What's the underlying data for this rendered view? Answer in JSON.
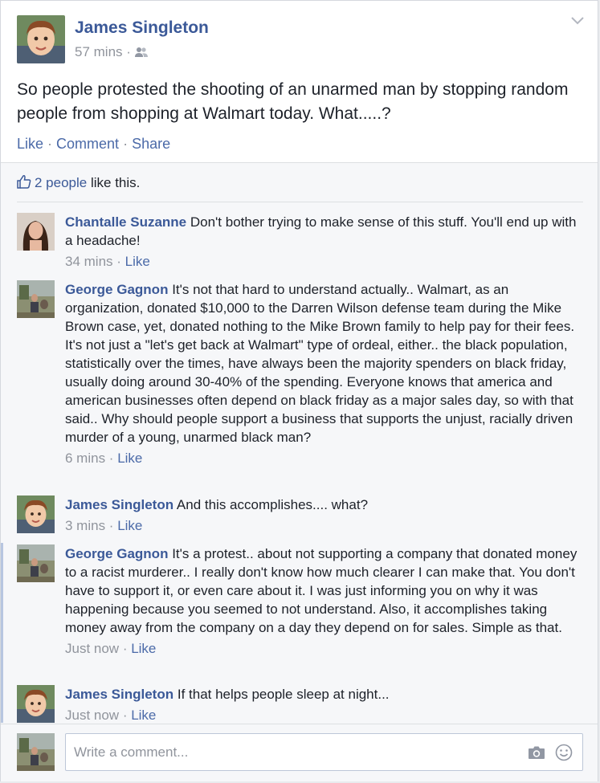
{
  "post": {
    "author": "James Singleton",
    "time": "57 mins",
    "meta_sep": "·",
    "privacy_icon": "friends-icon",
    "text": "So people protested the shooting of an unarmed man by stopping random people from shopping at Walmart today. What.....?",
    "actions": {
      "like": "Like",
      "comment": "Comment",
      "share": "Share",
      "sep": " · "
    }
  },
  "likes": {
    "icon": "thumbs-up-icon",
    "count_link": "2 people",
    "suffix": " like this."
  },
  "comments": [
    {
      "author": "Chantalle Suzanne",
      "text": "Don't bother trying to make sense of this stuff. You'll end up with a headache!",
      "time": "34 mins",
      "like": "Like"
    },
    {
      "author": "George Gagnon",
      "text": "It's not that hard to understand actually.. Walmart, as an organization, donated $10,000 to the Darren Wilson defense team during the Mike Brown case, yet, donated nothing to the Mike Brown family to help pay for their fees. It's not just a \"let's get back at Walmart\" type of ordeal, either.. the black population, statistically over the times, have always been the majority spenders on black friday, usually doing around 30-40% of the spending. Everyone knows that america and american businesses often depend on black friday as a major sales day, so with that said.. Why should people support a business that supports the unjust, racially driven murder of a young, unarmed black man?",
      "time": "6 mins",
      "like": "Like"
    },
    {
      "author": "James Singleton",
      "text": "And this accomplishes.... what?",
      "time": "3 mins",
      "like": "Like"
    },
    {
      "author": "George Gagnon",
      "text": "It's a protest.. about not supporting a company that donated money to a racist murderer.. I really don't know how much clearer I can make that. You don't have to support it, or even care about it. I was just informing you on why it was happening because you seemed to not understand. Also, it accomplishes taking money away from the company on a day they depend on for sales. Simple as that.",
      "time": "Just now",
      "like": "Like"
    },
    {
      "author": "James Singleton",
      "text": "If that helps people sleep at night...",
      "time": "Just now",
      "like": "Like"
    }
  ],
  "composer": {
    "placeholder": "Write a comment...",
    "camera_icon": "camera-icon",
    "emoji_icon": "smiley-icon"
  },
  "colors": {
    "link": "#3b5998",
    "meta_gray": "#90949c",
    "text": "#1d2129",
    "feedback_bg": "#f6f7f9"
  }
}
